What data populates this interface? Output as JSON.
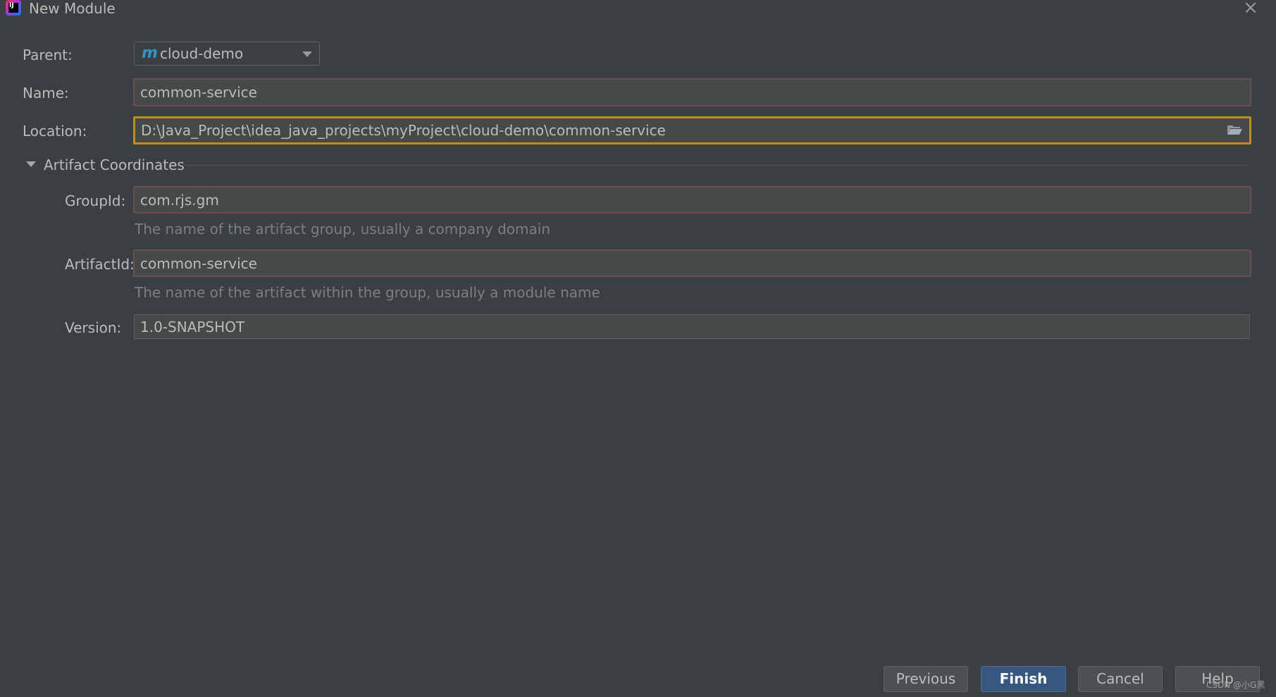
{
  "window": {
    "title": "New Module",
    "close_icon": "×"
  },
  "form": {
    "parent": {
      "label": "Parent:",
      "value": "cloud-demo",
      "icon_glyph": "m"
    },
    "name": {
      "label": "Name:",
      "value": "common-service"
    },
    "location": {
      "label": "Location:",
      "value": "D:\\Java_Project\\idea_java_projects\\myProject\\cloud-demo\\common-service"
    }
  },
  "artifact": {
    "section_title": "Artifact Coordinates",
    "group_id": {
      "label": "GroupId:",
      "value": "com.rjs.gm",
      "hint": "The name of the artifact group, usually a company domain"
    },
    "artifact_id": {
      "label": "ArtifactId:",
      "value": "common-service",
      "hint": "The name of the artifact within the group, usually a module name"
    },
    "version": {
      "label": "Version:",
      "value": "1.0-SNAPSHOT"
    }
  },
  "buttons": {
    "previous": "Previous",
    "finish": "Finish",
    "cancel": "Cancel",
    "help": "Help"
  },
  "watermark": "CSDN @小G黑",
  "colors": {
    "background": "#3c3f41",
    "field_bg": "#45494a",
    "error_border": "#6b4f53",
    "focus_border": "#c48a1d",
    "primary_button": "#365880"
  }
}
